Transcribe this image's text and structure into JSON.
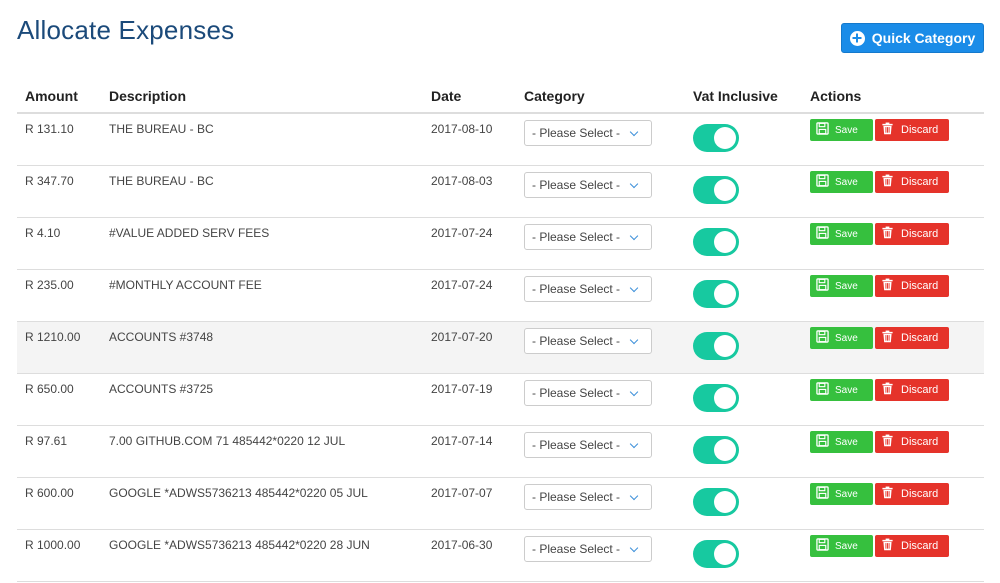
{
  "page": {
    "title": "Allocate Expenses",
    "quick_category_label": "Quick Category"
  },
  "table": {
    "columns": [
      "Amount",
      "Description",
      "Date",
      "Category",
      "Vat Inclusive",
      "Actions"
    ],
    "select_placeholder": "- Please Select -",
    "save_label": "Save",
    "discard_label": "Discard",
    "rows": [
      {
        "amount": "R 131.10",
        "description": "THE BUREAU - BC",
        "date": "2017-08-10",
        "vat_inclusive": true
      },
      {
        "amount": "R 347.70",
        "description": "THE BUREAU - BC",
        "date": "2017-08-03",
        "vat_inclusive": true
      },
      {
        "amount": "R 4.10",
        "description": "#VALUE ADDED SERV FEES",
        "date": "2017-07-24",
        "vat_inclusive": true
      },
      {
        "amount": "R 235.00",
        "description": "#MONTHLY ACCOUNT FEE",
        "date": "2017-07-24",
        "vat_inclusive": true
      },
      {
        "amount": "R 1210.00",
        "description": "ACCOUNTS #3748",
        "date": "2017-07-20",
        "vat_inclusive": true
      },
      {
        "amount": "R 650.00",
        "description": "ACCOUNTS #3725",
        "date": "2017-07-19",
        "vat_inclusive": true
      },
      {
        "amount": "R 97.61",
        "description": "7.00 GITHUB.COM 71 485442*0220 12 JUL",
        "date": "2017-07-14",
        "vat_inclusive": true
      },
      {
        "amount": "R 600.00",
        "description": "GOOGLE *ADWS5736213 485442*0220 05 JUL",
        "date": "2017-07-07",
        "vat_inclusive": true
      },
      {
        "amount": "R 1000.00",
        "description": "GOOGLE *ADWS5736213 485442*0220 28 JUN",
        "date": "2017-06-30",
        "vat_inclusive": true
      }
    ]
  },
  "colors": {
    "title": "#1b4a7a",
    "primary_button": "#1a8ce8",
    "toggle_on": "#17c9a0",
    "save_button": "#36c03e",
    "discard_button": "#e5332a"
  },
  "icons": {
    "quick_category": "plus-circle-icon",
    "save": "floppy-disk-icon",
    "discard": "trash-icon",
    "select": "chevron-down-icon"
  }
}
